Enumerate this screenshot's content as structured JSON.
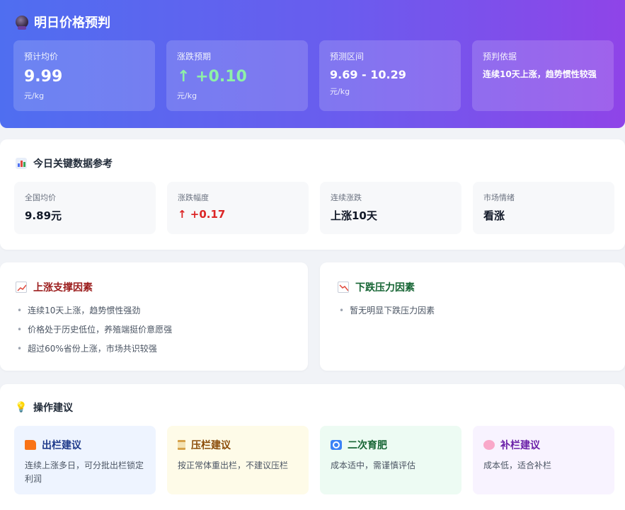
{
  "header": {
    "title": "明日价格预判",
    "cards": [
      {
        "label": "预计均价",
        "value": "9.99",
        "unit": "元/kg"
      },
      {
        "label": "涨跌预期",
        "value": "↑ +0.10",
        "unit": "元/kg"
      },
      {
        "label": "预测区间",
        "value": "9.69 - 10.29",
        "unit": "元/kg"
      },
      {
        "label": "预判依据",
        "value": "连续10天上涨，趋势惯性较强"
      }
    ]
  },
  "today": {
    "title": "今日关键数据参考",
    "items": [
      {
        "label": "全国均价",
        "value": "9.89元"
      },
      {
        "label": "涨跌幅度",
        "value": "↑ +0.17"
      },
      {
        "label": "连续涨跌",
        "value": "上涨10天"
      },
      {
        "label": "市场情绪",
        "value": "看涨"
      }
    ]
  },
  "up_factors": {
    "title": "上涨支撑因素",
    "items": [
      "连续10天上涨，趋势惯性强劲",
      "价格处于历史低位，养殖端挺价意愿强",
      "超过60%省份上涨，市场共识较强"
    ]
  },
  "down_factors": {
    "title": "下跌压力因素",
    "items": [
      "暂无明显下跌压力因素"
    ]
  },
  "advice": {
    "title": "操作建议",
    "items": [
      {
        "title": "出栏建议",
        "desc": "连续上涨多日，可分批出栏锁定利润"
      },
      {
        "title": "压栏建议",
        "desc": "按正常体重出栏，不建议压栏"
      },
      {
        "title": "二次育肥",
        "desc": "成本适中，需谨慎评估"
      },
      {
        "title": "补栏建议",
        "desc": "成本低，适合补栏"
      }
    ]
  },
  "colors": {
    "hero_start": "#4f6ef0",
    "hero_end": "#8f44e8",
    "up_red": "#dc2626",
    "up_green": "#8ef0a8"
  }
}
